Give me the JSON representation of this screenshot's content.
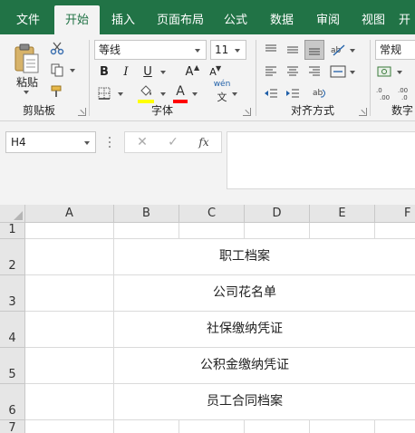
{
  "tabs": [
    "文件",
    "开始",
    "插入",
    "页面布局",
    "公式",
    "数据",
    "审阅",
    "视图",
    "开"
  ],
  "active_tab": "开始",
  "clipboard": {
    "paste_label": "粘贴",
    "group_label": "剪贴板"
  },
  "font": {
    "name": "等线",
    "size": "11",
    "bold": "B",
    "italic": "I",
    "underline": "U",
    "grow": "A",
    "shrink": "A",
    "font_color_letter": "A",
    "highlight_color": "#ffff00",
    "font_color": "#ff0000",
    "phonetic": "wén",
    "phonetic_sub": "文",
    "group_label": "字体"
  },
  "alignment": {
    "group_label": "对齐方式"
  },
  "number": {
    "format": "常规",
    "group_label": "数字"
  },
  "formula_bar": {
    "name_box": "H4",
    "fx": "fx",
    "value": ""
  },
  "columns": [
    "A",
    "B",
    "C",
    "D",
    "E",
    "F"
  ],
  "rows": [
    "1",
    "2",
    "3",
    "4",
    "5",
    "6",
    "7"
  ],
  "cells": [
    "职工档案",
    "公司花名单",
    "社保缴纳凭证",
    "公积金缴纳凭证",
    "员工合同档案"
  ]
}
